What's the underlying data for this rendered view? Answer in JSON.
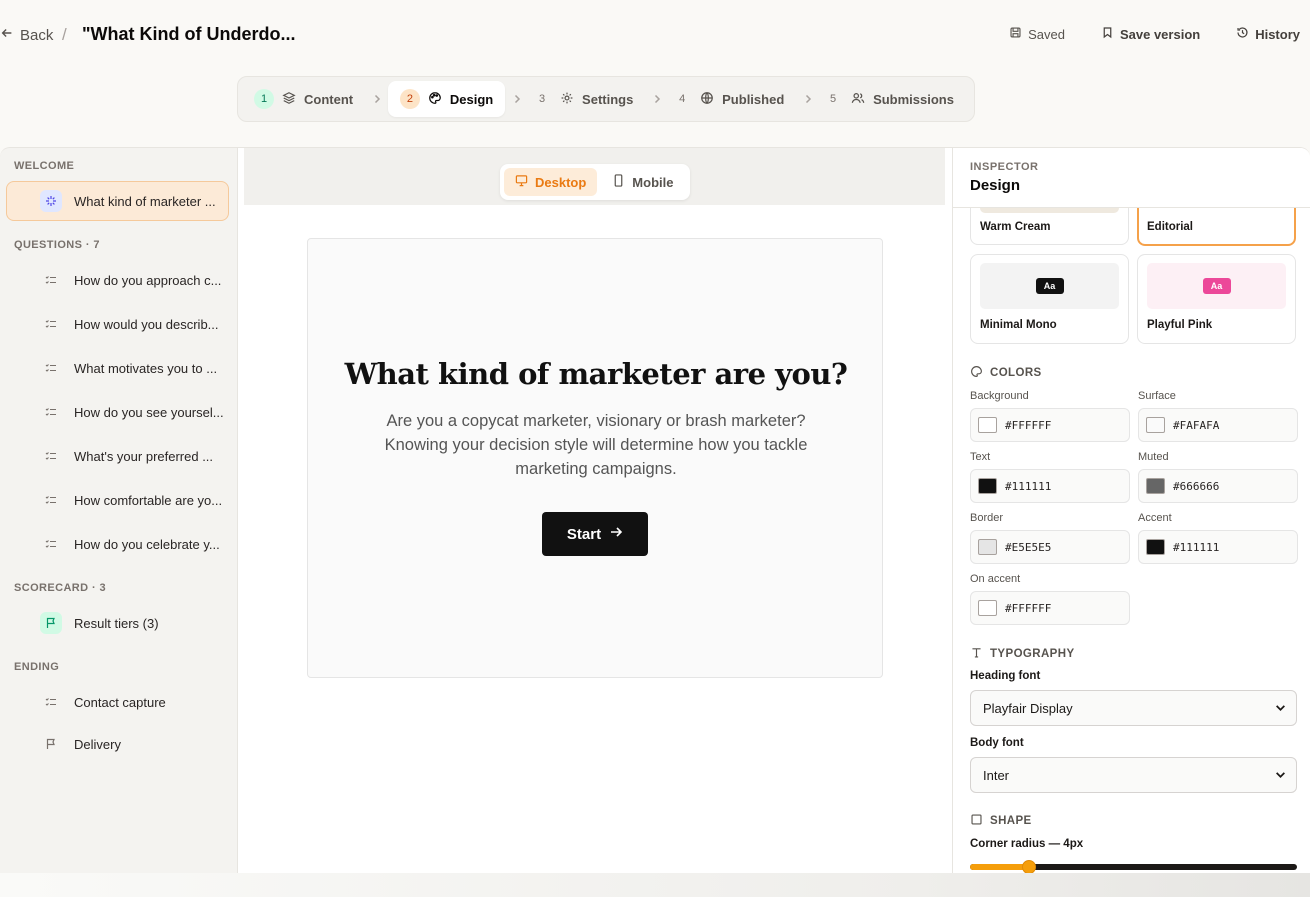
{
  "header": {
    "back_label": "Back",
    "separator": "/",
    "title": "\"What Kind of Underdo...",
    "saved_label": "Saved",
    "save_version_label": "Save version",
    "history_label": "History"
  },
  "stepper": {
    "steps": [
      {
        "num": "1",
        "label": "Content"
      },
      {
        "num": "2",
        "label": "Design"
      },
      {
        "num": "3",
        "label": "Settings"
      },
      {
        "num": "4",
        "label": "Published"
      },
      {
        "num": "5",
        "label": "Submissions"
      }
    ],
    "active": "Design"
  },
  "outline": {
    "welcome_section": "WELCOME",
    "welcome_item": "What kind of marketer ...",
    "questions_section": "QUESTIONS · 7",
    "questions": [
      "How do you approach c...",
      "How would you describ...",
      "What motivates you to ...",
      "How do you see yoursel...",
      "What's your preferred ...",
      "How comfortable are yo...",
      "How do you celebrate y..."
    ],
    "scorecard_section": "SCORECARD · 3",
    "scorecard_item": "Result tiers (3)",
    "ending_section": "ENDING",
    "ending_items": [
      "Contact capture",
      "Delivery"
    ]
  },
  "canvas": {
    "desktop_label": "Desktop",
    "mobile_label": "Mobile",
    "active_device": "Desktop",
    "heading": "What kind of marketer are you?",
    "body": "Are you a copycat marketer, visionary or brash marketer? Knowing your decision style will determine how you tackle marketing campaigns.",
    "start_label": "Start"
  },
  "inspector": {
    "kicker": "INSPECTOR",
    "title": "Design",
    "themes": [
      {
        "name": "Warm Cream",
        "swatch": "#efe9df",
        "aa": ""
      },
      {
        "name": "Editorial",
        "swatch": "#ffffff",
        "aa": ""
      },
      {
        "name": "Minimal Mono",
        "swatch": "#f3f3f3",
        "aa": "Aa",
        "aa_bg": "#111111"
      },
      {
        "name": "Playful Pink",
        "swatch": "#fdf0f5",
        "aa": "Aa",
        "aa_bg": "#ec4899"
      }
    ],
    "selected_theme": "Editorial",
    "colors_label": "COLORS",
    "colors": {
      "background": {
        "label": "Background",
        "value": "#FFFFFF"
      },
      "surface": {
        "label": "Surface",
        "value": "#FAFAFA"
      },
      "text": {
        "label": "Text",
        "value": "#111111"
      },
      "muted": {
        "label": "Muted",
        "value": "#666666"
      },
      "border": {
        "label": "Border",
        "value": "#E5E5E5"
      },
      "accent": {
        "label": "Accent",
        "value": "#111111"
      },
      "on_accent": {
        "label": "On accent",
        "value": "#FFFFFF"
      }
    },
    "typography_label": "TYPOGRAPHY",
    "heading_font_label": "Heading font",
    "heading_font": "Playfair Display",
    "body_font_label": "Body font",
    "body_font": "Inter",
    "shape_label": "SHAPE",
    "corner_radius_label": "Corner radius — 4px",
    "corner_radius_fraction": 0.18
  },
  "colors": {
    "accent_orange": "#ea7a12",
    "selection_bg": "#fcead7"
  }
}
